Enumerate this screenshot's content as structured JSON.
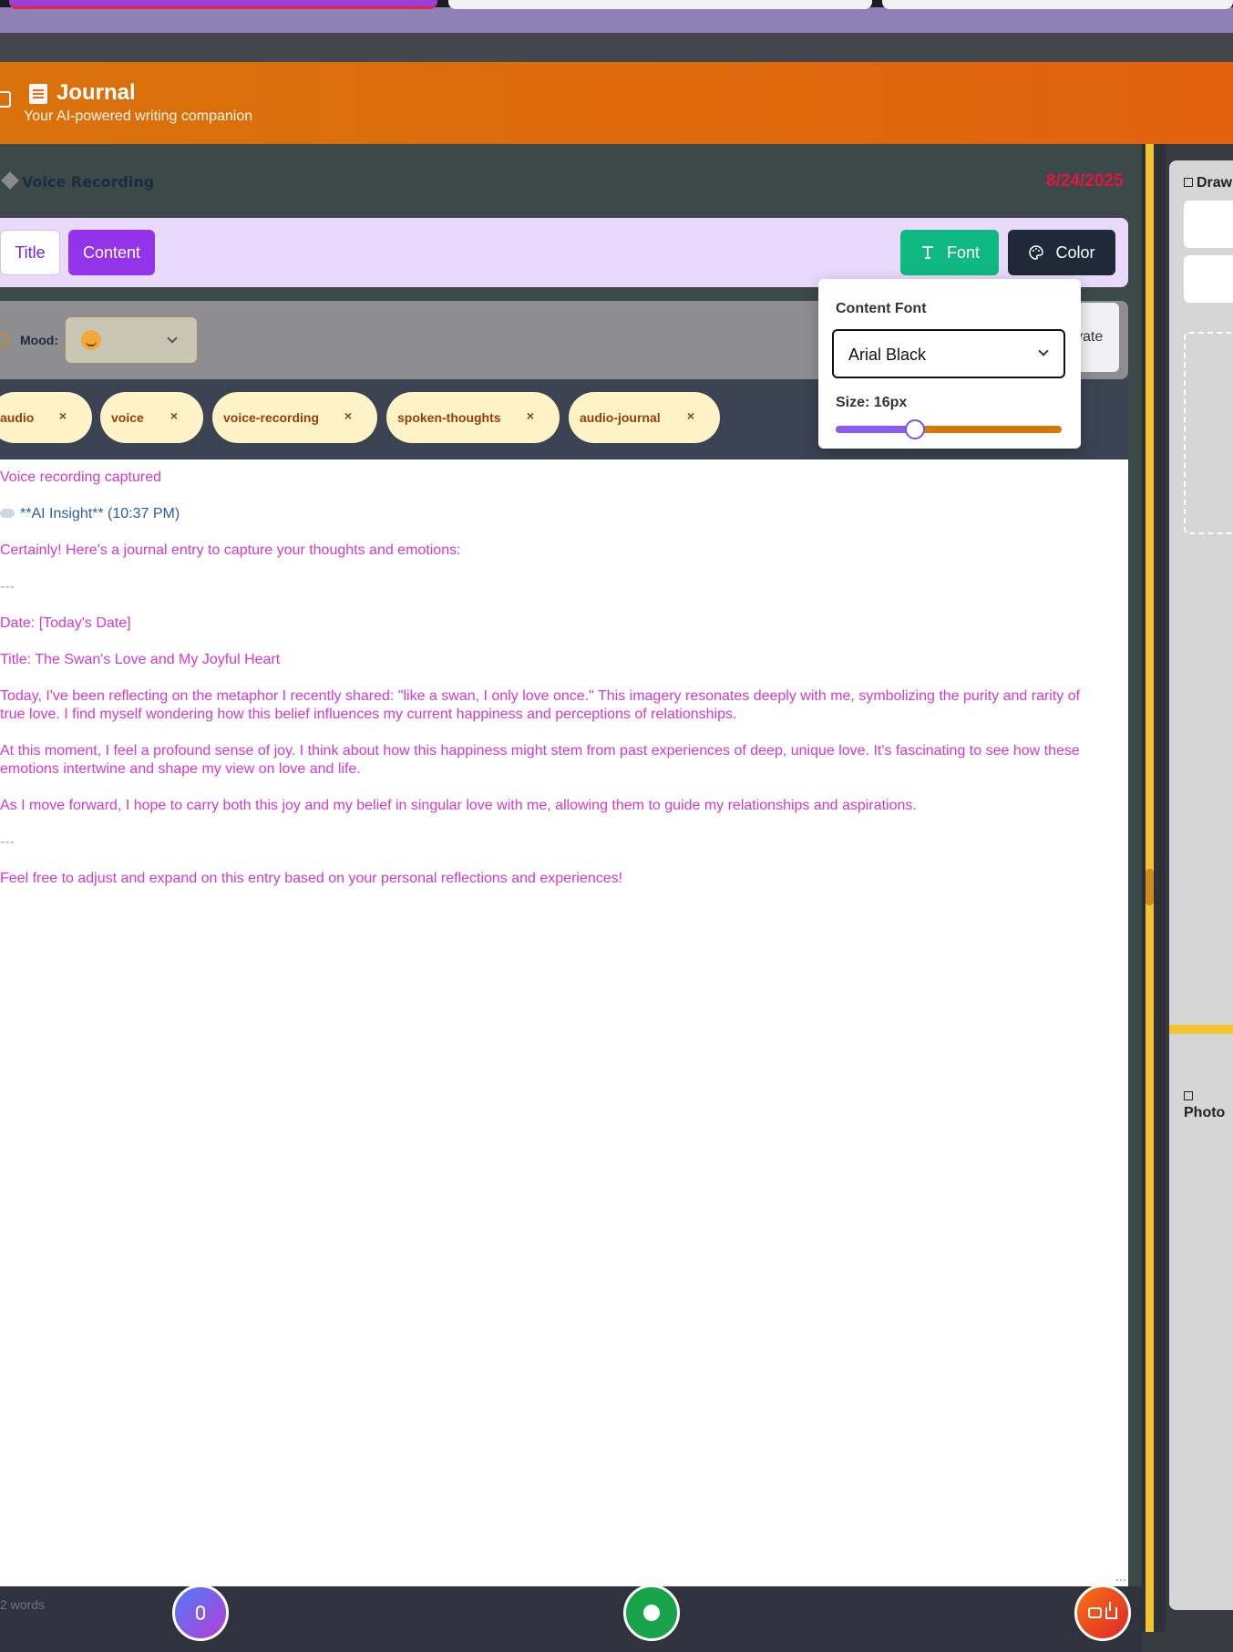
{
  "header": {
    "title": "Journal",
    "subtitle": "Your AI-powered writing companion"
  },
  "entry": {
    "section_label": "Voice Recording",
    "date": "8/24/2025"
  },
  "toolbar": {
    "title_label": "Title",
    "content_label": "Content",
    "font_label": "Font",
    "color_label": "Color"
  },
  "mood": {
    "label": "Mood:",
    "value": "😊"
  },
  "private_label": "vate",
  "tags": [
    "audio",
    "voice",
    "voice-recording",
    "spoken-thoughts",
    "audio-journal"
  ],
  "tag_remove": "×",
  "font_popover": {
    "label": "Content Font",
    "selected_font": "Arial Black",
    "size_label": "Size: 16px",
    "size_fraction": 0.35
  },
  "content": {
    "lines": [
      "Voice recording captured",
      "**AI Insight** (10:37 PM)",
      "Certainly! Here's a journal entry to capture your thoughts and emotions:",
      "---",
      "Date: [Today's Date]",
      "Title: The Swan's Love and My Joyful Heart",
      "Today, I've been reflecting on the metaphor I recently shared: \"like a swan, I only love once.\" This imagery resonates deeply with me, symbolizing the purity and rarity of true love. I find myself wondering how this belief influences my current happiness and perceptions of relationships.",
      "At this moment, I feel a profound sense of joy. I think about how this happiness might stem from past experiences of deep, unique love. It's fascinating to see how these emotions intertwine and shape my view on love and life.",
      "As I move forward, I hope to carry both this joy and my belief in singular love with me, allowing them to guide my relationships and aspirations.",
      "---",
      "Feel free to adjust and expand on this entry based on your personal reflections and experiences!"
    ]
  },
  "footer": {
    "word_count": "2 words"
  },
  "right_panel": {
    "drawing_title": "Draw",
    "photos_title": "Photo"
  },
  "colors": {
    "header_orange": "#e2680e",
    "content_button": "#9333ea",
    "font_button": "#10b981",
    "color_button": "#1f2937",
    "text_pink": "#d53acb",
    "date_red": "#e1153f",
    "tag_bg": "#fef3c7"
  }
}
